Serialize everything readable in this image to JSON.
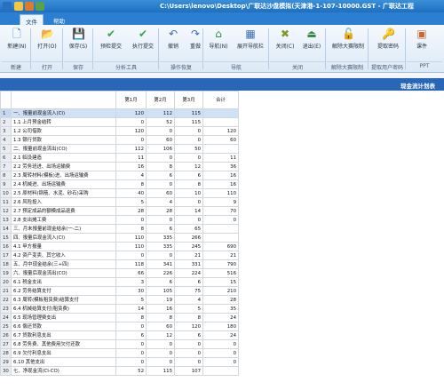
{
  "window": {
    "title": "C:\\Users\\lenovo\\Desktop\\广联达沙盘模拟(天津港-1-107-10000.GST - 广联达工程",
    "app_icon_color": "#2c6ec0",
    "qa_icon_colors": [
      "#f5c642",
      "#e07a2b",
      "#5aa14a"
    ]
  },
  "menu": {
    "tabs": [
      {
        "label": "文件",
        "active": true
      },
      {
        "label": "帮助",
        "active": false
      }
    ]
  },
  "ribbon": {
    "buttons": [
      {
        "id": "new",
        "label": "新建(N)",
        "icon": "new-file-icon",
        "glyph": "🗋",
        "color": "#3a6fb0"
      },
      {
        "id": "open",
        "label": "打开(O)",
        "icon": "open-folder-icon",
        "glyph": "📂",
        "color": "#d9a531"
      },
      {
        "id": "save",
        "label": "保存(S)",
        "icon": "save-icon",
        "glyph": "💾",
        "color": "#3361a8"
      },
      {
        "id": "pre-submit",
        "label": "预检提交",
        "icon": "check-icon",
        "glyph": "✔",
        "color": "#3aa34a"
      },
      {
        "id": "exec-submit",
        "label": "执行提交",
        "icon": "check-icon",
        "glyph": "✔",
        "color": "#3aa34a"
      },
      {
        "id": "undo",
        "label": "撤销",
        "icon": "undo-icon",
        "glyph": "↶",
        "color": "#3a6fb0"
      },
      {
        "id": "redo",
        "label": "重做",
        "icon": "redo-icon",
        "glyph": "↷",
        "color": "#3a6fb0"
      },
      {
        "id": "nav",
        "label": "导航(N)",
        "icon": "navigation-icon",
        "glyph": "⌂",
        "color": "#3a8a4a"
      },
      {
        "id": "expand-nav",
        "label": "展开导航栏",
        "icon": "expand-panel-icon",
        "glyph": "▦",
        "color": "#3a6fb0"
      },
      {
        "id": "close",
        "label": "关闭(C)",
        "icon": "close-doc-icon",
        "glyph": "✖",
        "color": "#7a9a2a"
      },
      {
        "id": "exit",
        "label": "退出(E)",
        "icon": "exit-icon",
        "glyph": "⏏",
        "color": "#3a8a4a"
      },
      {
        "id": "unlock-limit",
        "label": "解除大赛限制",
        "icon": "unlock-icon",
        "glyph": "🔓",
        "color": "#c43a3a"
      },
      {
        "id": "get-password",
        "label": "提取密码",
        "icon": "key-icon",
        "glyph": "🔑",
        "color": "#d9a531"
      },
      {
        "id": "courseware",
        "label": "课件",
        "icon": "courseware-icon",
        "glyph": "▣",
        "color": "#c4683a"
      }
    ],
    "groups": [
      "新建",
      "打开",
      "保存",
      "分析工具",
      "操作恢复",
      "导航",
      "关闭",
      "解除大赛限制",
      "提取用户密码",
      "PPT"
    ]
  },
  "report": {
    "title": "现金流计划表",
    "columns": [
      "第1月",
      "第2月",
      "第3月",
      "合计"
    ],
    "selected_row": 1,
    "rows": [
      {
        "n": "1",
        "name": "一、报量前现金流入(CI)",
        "v": [
          "120",
          "112",
          "115",
          ""
        ]
      },
      {
        "n": "2",
        "name": "1.1 上月预金结转",
        "v": [
          "0",
          "52",
          "115",
          ""
        ]
      },
      {
        "n": "3",
        "name": "1.2 公司借款",
        "v": [
          "120",
          "0",
          "0",
          "120"
        ]
      },
      {
        "n": "4",
        "name": "1.3 银行贷款",
        "v": [
          "0",
          "60",
          "0",
          "60"
        ]
      },
      {
        "n": "5",
        "name": "二、报量前现金流出(CO)",
        "v": [
          "112",
          "106",
          "50",
          ""
        ]
      },
      {
        "n": "6",
        "name": "2.1 临设建造",
        "v": [
          "11",
          "0",
          "0",
          "11"
        ]
      },
      {
        "n": "7",
        "name": "2.2 劳务班进、出场运输费",
        "v": [
          "16",
          "8",
          "12",
          "36"
        ]
      },
      {
        "n": "8",
        "name": "2.3 周转材料(模板)进、出场运输费",
        "v": [
          "4",
          "6",
          "6",
          "16"
        ]
      },
      {
        "n": "9",
        "name": "2.4 机械进、出场运输费",
        "v": [
          "8",
          "0",
          "8",
          "16"
        ]
      },
      {
        "n": "10",
        "name": "2.5 原材料(钢筋、水泥、砂石)采购",
        "v": [
          "40",
          "60",
          "10",
          "110"
        ]
      },
      {
        "n": "11",
        "name": "2.6 风险投入",
        "v": [
          "5",
          "4",
          "0",
          "9"
        ]
      },
      {
        "n": "12",
        "name": "2.7 预定成品的额模成品退费",
        "v": [
          "28",
          "28",
          "14",
          "70"
        ]
      },
      {
        "n": "13",
        "name": "2.8 支出摊工费",
        "v": [
          "0",
          "0",
          "0",
          "0"
        ]
      },
      {
        "n": "14",
        "name": "三、月末报量前现金结余(一-二)",
        "v": [
          "8",
          "6",
          "65",
          ""
        ]
      },
      {
        "n": "15",
        "name": "四、报量后现金流入(CI)",
        "v": [
          "110",
          "335",
          "266",
          ""
        ]
      },
      {
        "n": "16",
        "name": "4.1 甲方报量",
        "v": [
          "110",
          "335",
          "245",
          "690"
        ]
      },
      {
        "n": "17",
        "name": "4.2 资产变卖、其它收入",
        "v": [
          "0",
          "0",
          "21",
          "21"
        ]
      },
      {
        "n": "18",
        "name": "五、月中现金结余(三+四)",
        "v": [
          "118",
          "341",
          "331",
          "790"
        ]
      },
      {
        "n": "19",
        "name": "六、报量后现金流出(CO)",
        "v": [
          "66",
          "226",
          "224",
          "516"
        ]
      },
      {
        "n": "20",
        "name": "6.1 税金支出",
        "v": [
          "3",
          "6",
          "6",
          "15"
        ]
      },
      {
        "n": "21",
        "name": "6.2 劳务结算支付",
        "v": [
          "30",
          "105",
          "75",
          "210"
        ]
      },
      {
        "n": "22",
        "name": "6.3 周转(模板租赁费)结算支付",
        "v": [
          "5",
          "19",
          "4",
          "28"
        ]
      },
      {
        "n": "23",
        "name": "6.4 机械结算支付(租赁费)",
        "v": [
          "14",
          "16",
          "5",
          "35"
        ]
      },
      {
        "n": "24",
        "name": "6.5 现场管理费支出",
        "v": [
          "8",
          "8",
          "8",
          "24"
        ]
      },
      {
        "n": "25",
        "name": "6.6 偿还贷款",
        "v": [
          "0",
          "60",
          "120",
          "180"
        ]
      },
      {
        "n": "26",
        "name": "6.7 贷款利息支出",
        "v": [
          "6",
          "12",
          "6",
          "24"
        ]
      },
      {
        "n": "27",
        "name": "6.8 劳务费、其他费用欠付还款",
        "v": [
          "0",
          "0",
          "0",
          "0"
        ]
      },
      {
        "n": "28",
        "name": "6.9 欠付利息支出",
        "v": [
          "0",
          "0",
          "0",
          "0"
        ]
      },
      {
        "n": "29",
        "name": "6.10 其他支出",
        "v": [
          "0",
          "0",
          "0",
          "0"
        ]
      },
      {
        "n": "30",
        "name": "七、净现金流(CI-CO)",
        "v": [
          "52",
          "115",
          "107",
          ""
        ]
      }
    ]
  }
}
